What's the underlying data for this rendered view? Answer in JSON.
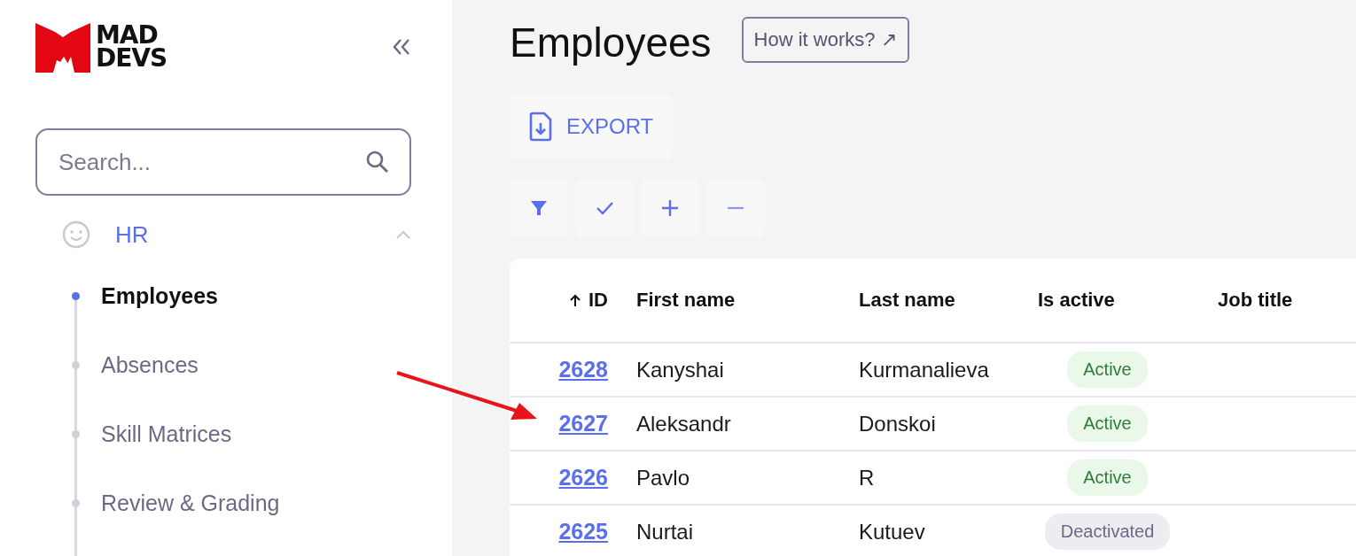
{
  "sidebar": {
    "logo": {
      "line1": "MAD",
      "line2": "DEVS"
    },
    "search": {
      "placeholder": "Search..."
    },
    "groups": [
      {
        "label": "HR",
        "expanded": true,
        "items": [
          {
            "label": "Employees",
            "selected": true
          },
          {
            "label": "Absences",
            "selected": false
          },
          {
            "label": "Skill Matrices",
            "selected": false
          },
          {
            "label": "Review & Grading",
            "selected": false
          }
        ]
      }
    ]
  },
  "page": {
    "title": "Employees",
    "help_link": "How it works? ↗",
    "export_button": "EXPORT",
    "toolbar": [
      {
        "kind": "filter"
      },
      {
        "kind": "check"
      },
      {
        "kind": "plus"
      },
      {
        "kind": "minus"
      }
    ]
  },
  "table": {
    "columns": [
      {
        "label": "ID",
        "sorted": true
      },
      {
        "label": "First name",
        "sorted": false
      },
      {
        "label": "Last name",
        "sorted": false
      },
      {
        "label": "Is active",
        "sorted": false
      },
      {
        "label": "Job title",
        "sorted": false
      }
    ],
    "rows": [
      {
        "id": "2628",
        "first_name": "Kanyshai",
        "last_name": "Kurmanalieva",
        "status": {
          "label": "Active",
          "active": true
        }
      },
      {
        "id": "2627",
        "first_name": "Aleksandr",
        "last_name": "Donskoi",
        "status": {
          "label": "Active",
          "active": true
        }
      },
      {
        "id": "2626",
        "first_name": "Pavlo",
        "last_name": "R",
        "status": {
          "label": "Active",
          "active": true
        }
      },
      {
        "id": "2625",
        "first_name": "Nurtai",
        "last_name": "Kutuev",
        "status": {
          "label": "Deactivated",
          "active": false
        }
      }
    ]
  },
  "annotation": {
    "kind": "arrow"
  }
}
